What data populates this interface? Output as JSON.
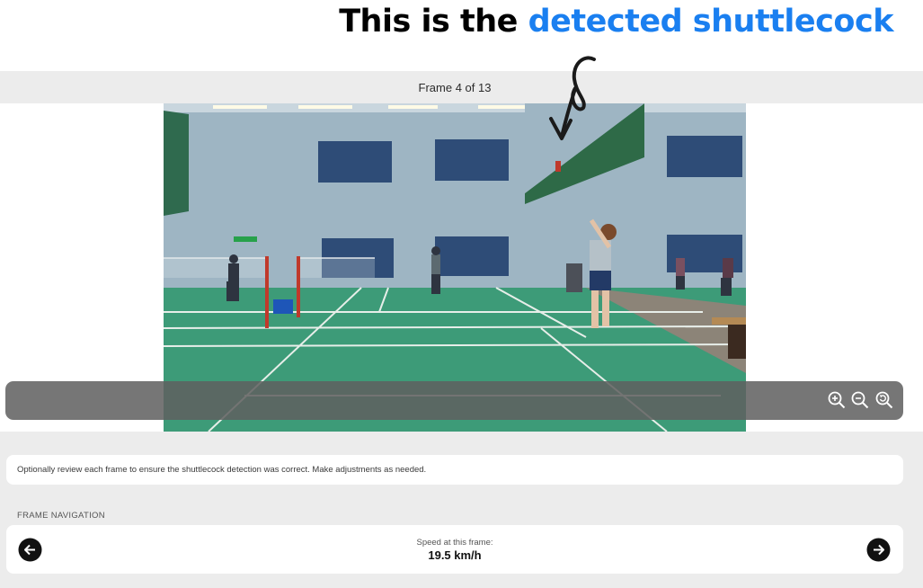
{
  "annotation": {
    "prefix": "This is the ",
    "highlight": "detected shuttlecock",
    "highlight_color": "#1a7ff0",
    "arrow_icon": "hand-drawn-curly-arrow-icon"
  },
  "viewer": {
    "frame_label": "Frame 4 of 13",
    "current_frame": 4,
    "total_frames": 13,
    "image_description_icon": "badminton-court-photo",
    "zoom_controls": [
      {
        "name": "zoom-in-icon"
      },
      {
        "name": "zoom-out-icon"
      },
      {
        "name": "zoom-reset-icon"
      }
    ]
  },
  "instructions": {
    "text": "Optionally review each frame to ensure the shuttlecock detection was correct. Make adjustments as needed."
  },
  "frame_navigation": {
    "section_title": "FRAME NAVIGATION",
    "speed_caption": "Speed at this frame:",
    "speed_value": "19.5 km/h",
    "prev_icon": "arrow-left-circle-icon",
    "next_icon": "arrow-right-circle-icon"
  }
}
